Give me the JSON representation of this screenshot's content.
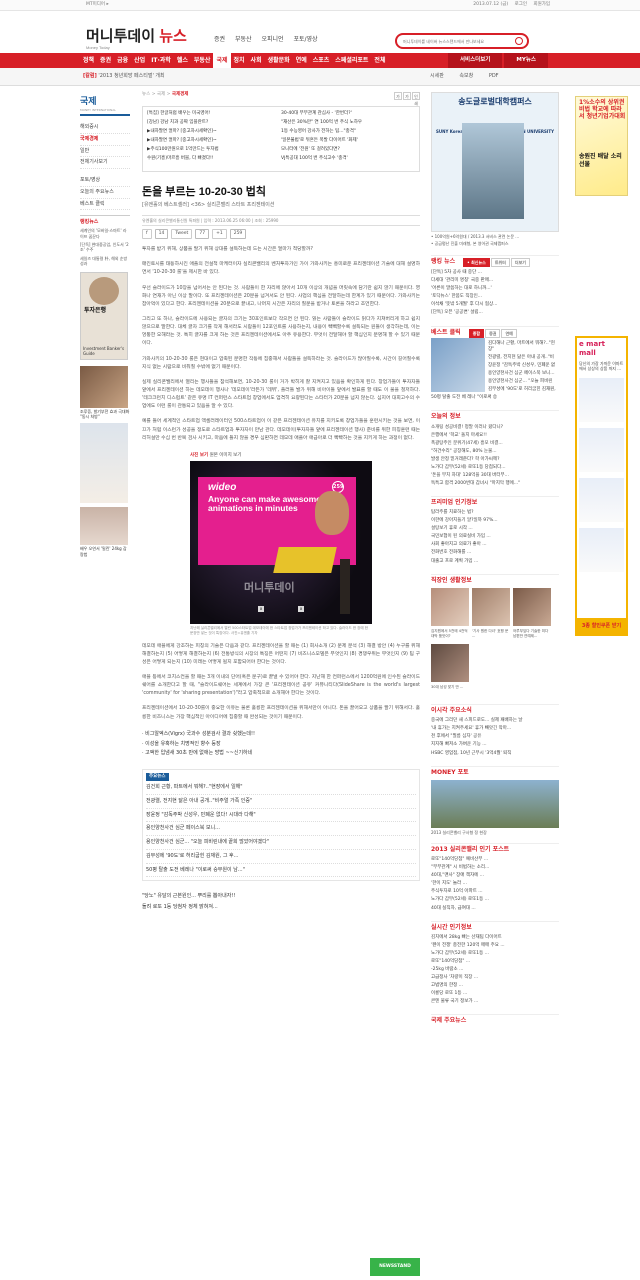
{
  "util": {
    "left": "MT미디어 ▸",
    "right": [
      "2013.07.12 (금)",
      "로그인",
      "회원가입"
    ]
  },
  "brand": {
    "logo_main": "머니투데이",
    "logo_accent": "뉴스",
    "logo_sub": "Money Today"
  },
  "header_nav": [
    "증권",
    "부동산",
    "오피니언",
    "포토/영상"
  ],
  "search": {
    "placeholder": "머니투데이를 네이버 뉴스스탠드에서 만나보세요"
  },
  "mainnav": {
    "items": [
      "정책",
      "증권",
      "금융",
      "산업",
      "IT·과학",
      "헬스",
      "부동산",
      "국제",
      "정치",
      "사회",
      "생활문화",
      "연예",
      "스포츠",
      "스페셜리포트",
      "전체"
    ],
    "active": "국제",
    "ext": [
      "서비스더보기",
      "MY뉴스"
    ]
  },
  "subbar": {
    "hot_tag": "[칼럼]",
    "hot_text": "'2013 청년희망 페스티벌' 개최",
    "tools": [
      "시세판",
      "속보창",
      "PDF"
    ]
  },
  "left": {
    "section_title": "국제",
    "section_sub": "MONEY INTERNATIONAL",
    "menu": [
      "해외증시",
      "국제경제",
      "일반",
      "전체기사보기"
    ],
    "active_menu": "국제경제",
    "menu2": [
      "포토/영상",
      "오늘의 주요뉴스",
      "베스트 클릭"
    ],
    "box_title": "랭킹뉴스",
    "box_items": [
      "세계인의 '모바일·스마트' 라이프 꿈꾼다",
      "[단독] 현대중공업, 인도서 '2조' 수주",
      "세일즈 대통령 朴, 해외 순방 성과"
    ],
    "book_title": "투자은행",
    "book_caption": "Investment Banker's Guide",
    "ad1_text": "조루증, 발기부전 효과 극대화 \"동시 처방\"",
    "ad3_text": "배우 오연서 '밀린' 24kg 감량법"
  },
  "article": {
    "breadcrumb": [
      "뉴스",
      "국제",
      "국제경제"
    ],
    "font_controls": [
      "가",
      "가",
      "인쇄"
    ],
    "related_left": [
      "[특집] 한글처럼 배우는 미국영어!",
      "[강남] 강남 치과 공짜 임플란트?",
      "▶내차팔면 얼마? [중고차시세확인]~",
      "▶내차팔면 얼마? [중고차시세확인]~",
      "▶주식100만원으로 1억만드는 투자법",
      "수원(기흥)마르흥 버블, 다 빠졌다!!"
    ],
    "related_right": [
      "30-40대 부부관계 관심사 - '한번더?'",
      "\"재산은 30%만\" 연 100억 번 주식 노하우",
      "1등 수능영어 강사가 전하는 팁...\"충격\"",
      "'일본불법'로 뒤흔든 폭발 다이어트 '화제'",
      "모니터에 '전원' 또 걸려있다면?",
      "VJ특공대 100억 번 주식고수 '충격'"
    ],
    "title": "돈을 부르는 10-20-30 법칙",
    "subtitle": "[유엔홀의 베스트셀러] <36> 실리콘밸리 스타트 프리젠테이션",
    "meta": "유엔홀의 실리콘밸리통신원 특파원 | 입력 : 2013.06.25 06:00 | 조회 : 25990",
    "share": {
      "f_count": "14",
      "tweet": "Tweet",
      "t_count": "77",
      "g_count": "259"
    },
    "lead": "투자를 받기 위해, 상품을 팔기 위해 상대를 설득하는데 드는 시간은 얼마가 적당할까?",
    "p1": "매킨토시를 태동하시킨 애플의 전설적 마케터이자 실리콘밸리의 벤처투자가인 가이 가와사키는 흥미로운 프리젠테이션 기술에 대해 설명하면서 '10-20-30 룰'을 제시한 바 있다.",
    "p2": "우선 슬라이드가 10장을 넘어서는 안 된다는 것. 사람들이 한 자리에 앉아서 10개 이상의 개념을 머릿속에 담기란 쉽지 않기 때문이다. 영화나 연재가 아닌 이상 말이다. 또 프리젠테이션은 20분을 넘겨서도 안 된다. 사업의 핵심을 전달하는데 한계가 있기 때문이다. 가와사키는 잡아먹이 있다고 한다. 프리젠테이션을 20분으로 끝내고, 나머지 시간은 자리의 질문을 받거나 토론을 하라고 조언한다.",
    "p3": "그리고 또 하나, 슬라이드에 사용되는 글자의 크기는 30포인트보다 작으면 안 된다. 읽는 사람들이 슬라이드 읽다가 지쳐버리게 하고 쉽지 않으므로 말한다. 대체 글자 크기를 작게 해서라도 시람들이 12포인트를 사용하는지, 내용이 빽빽할수록 설득되는 원들이 생각하는데, 이는 엉뚱한 오해라는 것. 특히 글자를 크게 하는 것은 프리젠테이션에서도 아주 유용한다. 무엇이 전달해야 할 핵심인지 분명해 할 수 있기 때문이다.",
    "p4": "가와사키의 10-20-30 룰은 현대이고 압축된 분명한 작동에 집중해서 사람들을 설득하라는 것. 슬라이드가 많아질수록, 시간이 길어질수록 지식 없는 시람으로 비춰질 수밖에 없기 때문이다.",
    "p5": "실제 실리콘밸리에서 열리는 행사들을 참석해보면, 10-20-30 룰이 거가 박히게 잘 지켜지고 있음을 확인하게 된다. 창업가들이 투자자들 앞에서 프리젠테이션 하는 데모데이 행사나 '데모데이'라든가 '데뷔', 플러들 발가 위해 비아이들 앞에서 발표를 할 때도 이 물을 철저하다. '테크크런치 디스럽트' 같은 유명 IT 컨퍼런스 스타트업 창업에서도 엄격히 요량된다는 스타터가 20분을 넘지 않는다. 심지어 대회고수의 수업에도 이런 룰이 관통되고 있음을 알 수 있다.",
    "p6": "예를 들어 세계적인 스타트업 액셀러레이터인 500스타트업이 이 같은 프리젠테이션 유치를 지키도록 창업가들을 훈련시키는 것을 보면, 이끄가 처럼 이스런가 성공을 정도로 스타트업과 투자자이 만남 관다. 데모데이(투자자들 앞에 프리젠테이션 행사) 준비를 위한 피칭훈련 때는 리허설만 수십 번 반복 검사 시키고, 마음에 들지 않을 경우 심판하면 데모데 애플아 애급아로 더 빡빡하는 것을 지키게 하는 과정이 없다.",
    "photo_label": "사진 보기",
    "photo_label_right": "원본 이미지 보기",
    "slide_title": "wideo",
    "slide_text": "Anyone can make awesome animations in minutes",
    "slide_num": "259",
    "watermark": "머니투데이",
    "photo_caption": "지난해 실리콘밸리에서 열린 500스타트업 데모데이에 한 스타트업 창업가가 프리젠테이션 하고 있다. 슬라이드 한 장에 한 문장만 넣는 것이 특징이다. 사진=유엔홀 기자",
    "p7": "데모데 애플에게 강조하는 피칭의 기술은 다음과 같다. 프리젠테이션을 할 때는 (1) 회사소개 (2) 문제 분석 (3) 해결 방안 (4) 누구를 위해 해결하는지 (5) 어떻게 해결하는지 (6) 전통방식의 시장의 특징은 어떤지 (7) 비즈니스모델은 무엇인지 (8) 경쟁우위는 무엇인지 (9) 팀 구성은 어떻게 되는지 (10) 미래는 어떻게 될지 포함되어야 한다는 것이다.",
    "p8": "애플 등에서 코치스컨을 할 때는 3개 이내의 단어(혹은 문구)로 끝낼 수 있어야 한다. 지난해 한 컨퍼런스에서 1200억원에 인수된 슬라이드쉐어를 소개한다고 할 때, \"슬라이드쉐어는 세계에서 가장 큰 '프리젠테이션 공유' 커뮤니티다(SlideShare is the world's largest 'community' for 'sharing presentation')\"라고 압축적으로 소개해야 한다는 것이다.",
    "p9": "프리젠테이션에서 10-20-30룰이 중요한 이유는 물론 훌륭한 프리젠테이션을 위해서만이 아니다. 돈을 끌어오고 상품을 팔기 위해서다. 훌륭한 비즈니스는 가장 핵심적인 아이디어에 집중할 때 완성되는 것이기 때문이다.",
    "bullets": [
      "· 비그알엑스(Vigrx) 국과수 성분검사 결과 쉿했는데!!",
      "· 이성을 유혹하는 치명적인 향수 등장",
      "· 고액한 입냄새 30초 만에 없애는 방법 ~~신기하네"
    ],
    "more_title": "주요뉴스",
    "more_items": [
      "김건희 근황, 파트에서 뭐해?..\"현장에서 일해\"",
      "전광렬, 전지현 닮은 아내 공개..\"비주얼 가족 인증\"",
      "장윤정 \"감독주박 신성우, 민폐운 없다! 시대라 다해\"",
      "용인양천사건 심군 페이스북 보니...",
      "용인양천사건 심군... \"오늘 피비린내에 끝희 많았어야겠다\"",
      "김무성에 '90도'로 허리굽힌 김재원, 그 후...",
      "50평 탈출 도전 베레나 \"이로써 승무원이 남...\""
    ],
    "more2_items": [
      "\"당노\" 유달의 근본원인... 뿌리를 뽑아내자!!",
      "돌려 로또 1등 당첨자 정체 밝혀져..."
    ],
    "newsstand": "NEWSSTAND"
  },
  "right": {
    "campus_title": "송도글로벌대학캠퍼스",
    "campus_logo1": "SUNY Korea",
    "campus_logo2": "GEORGE MASON UNIVERSITY",
    "campus_text": "• 100억원+6억원대 / 2013.3 서비스 관련 논문 ...",
    "campus_text2": "• 공급평난 진출 미래형, 본 영어권 국제캠퍼스",
    "ranking_title": "랭킹 뉴스",
    "ranking_tabs": [
      "• 최신뉴스",
      "트위터",
      "더보기"
    ],
    "ranking_items": [
      "[단독] 5차 공사 때 중단 ...",
      "다세대 '관리미 명칭' 국중 판매...",
      "'어른이 말씀하는 대로 하니까...'",
      "'토닥뉴스' 한몸도 직장인...",
      "이석채 '뜻밖 5개월' 후 다시 협상...",
      "[단독] 오픈 '공공변' 설립..."
    ],
    "best_title": "베스트 클릭",
    "best_tabs": [
      "종합",
      "증권",
      "연예"
    ],
    "best_items": [
      "김다해나 근황, 마트에서 뭐해?..\"현장\"",
      "전광렬, 전지현 닮은 아내 공개..\"비",
      "장윤정 \"감독주박 신성우, 민폐운 없",
      "용인양천사건 심군 페이스북 보니...",
      "용인양천사건 심군... \"오늘 피비린",
      "김무성에 '90도'로 허리굽힌 김재원,",
      "50평 탈출 도전 베 레나 \"이로써 승"
    ],
    "today_title": "오늘의 정보",
    "today_items": [
      "소개팅 성공비결! 정말 이러나 왔다니?",
      "은행에서 '학교' 돌지 마세요!!",
      "폭광탕주인 분위기(47세) 흥모 비결...",
      "\"허건수리\" 공장해도, 80% 눈물...",
      "발생 안정 밑거래준다? 학 아가씨께?",
      "노가다 갑부(52세) 로또1등 당첨되다...",
      "'돈을 부치 차대' 128억을 30대 버터부...",
      "독특고 합격 2000번대 갑녀시 \"마지막 행에...\""
    ],
    "franchise_title": "프리미엄 인기정보",
    "franchise_items": [
      "탐라주를 치료하는 법?",
      "이한에 강아지들기 알?일까 97%...",
      "설탕보기 휴로 시작 ...",
      "국민보험이 된 의료실비 가입 ...",
      "사회 좋아지고 의료가 좋아 ...",
      "전화번호 전화해를 ...",
      "대출고 프로 계획 가입 ..."
    ],
    "photo_title": "직장인 생활정보",
    "photo_items": [
      "김지원에서 5천에 4천억 대박 품앗이?",
      "'기사 원한 다녀' 호평 문 ...",
      "어루부잎다 기술한 미다 남편만 연예제...",
      "30대 남성 맞기 만 ..."
    ],
    "issue_title": "이시각 주요소식",
    "issue_items": [
      "중국에 그리던 새 스피드로도... 실제 패배하는 날",
      "'내 휴가는 지켜주세요' 휴가 빼앗긴 악마...",
      "천 후에서 \"필름 심자' 공유",
      "지지해 빠져소 가벼운 기능 ...",
      "HSBC 영업점, 10년 근무시 '3억4월' 퇴직"
    ],
    "money_title": "MONEY 포토",
    "money_caption": "2013 실리콘밸리 구사형 정 현장",
    "popular_title": "2013 실리콘밸리 인기 포스트",
    "popular_items": [
      "로또\"140억당첨\" 예비산부 ...",
      "\"부부관계\" 시 비법하는 소리...",
      "40대,\"맨사\" 장애 책자에 ...",
      "'한이 지도' 놀라 ...",
      "주식투자로 10억 아파트 ...",
      "노가다 갑부(52세) 로또1등 ...",
      "40대 실직자, 급여대 ..."
    ],
    "live_title": "실시간 인기정보",
    "live_items": [
      "김치에서 28kg 빠는 산재팀 다이어트",
      "'펜이 전쟁' 충전한 120억 매매 주요 ...",
      "노가다 갑부(52세) 로또1등 ...",
      "로또\"140억당첨\" ...",
      "-25kg 바람소 ...",
      "고급정사 '차량이 직장 ...",
      "고법명의 한정 ...",
      "이룡당 로또 1등 ...",
      "콘텐 물류 국기 정보가 ..."
    ],
    "bottom_title": "국제 주요뉴스"
  },
  "ad_right": {
    "top_text": "1%소수의 상위권 비법 학교에 따라서 청년기업가대회",
    "mid_text": "송원진 배달 소리선물",
    "emart_title": "e mart mall",
    "emart_text": "당신의 가장 가까운 이마트에서 상상의 상품 까지 ...",
    "emart_btn": "3종 할인쿠폰 받기"
  }
}
